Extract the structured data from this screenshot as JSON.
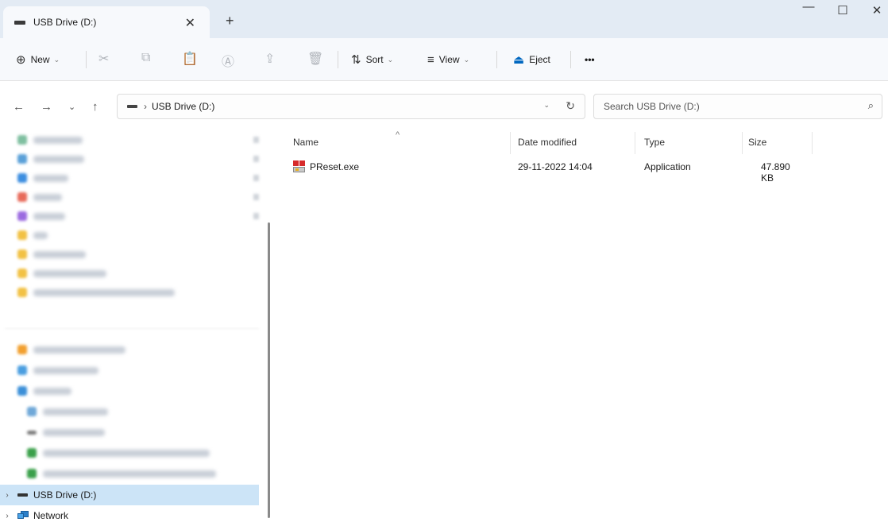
{
  "window": {
    "tab_title": "USB Drive (D:)",
    "tab_close": "✕",
    "new_tab": "+",
    "min": "—",
    "max": "☐",
    "close": "✕"
  },
  "toolbar": {
    "new_label": "New",
    "new_icon": "⊕",
    "sort_label": "Sort",
    "sort_icon": "⇅",
    "view_label": "View",
    "view_icon": "≡",
    "eject_label": "Eject",
    "eject_icon": "⏏",
    "more_label": "•••",
    "dropdown_chevron": "⌄",
    "cut_icon": "✂",
    "copy_icon": "⧉",
    "paste_icon": "📋",
    "rename_icon": "Ⓐ",
    "share_icon": "⇪",
    "delete_icon": "🗑"
  },
  "navigation": {
    "back": "←",
    "forward": "→",
    "recent": "⌄",
    "up": "↑",
    "breadcrumb_sep": "›",
    "breadcrumb": [
      "USB Drive (D:)"
    ],
    "address_dropdown": "⌄",
    "refresh": "↻"
  },
  "search": {
    "placeholder": "Search USB Drive (D:)",
    "icon": "⌕"
  },
  "sidebar": {
    "items": [
      {
        "label": "USB Drive (D:)",
        "expander": "›",
        "icon": "drive-icon",
        "selected": true
      },
      {
        "label": "Network",
        "expander": "›",
        "icon": "network-icon",
        "selected": false
      }
    ]
  },
  "file_list": {
    "columns": {
      "name": "Name",
      "date": "Date modified",
      "type": "Type",
      "size": "Size"
    },
    "sort_indicator": "^",
    "rows": [
      {
        "name": "PReset.exe",
        "date": "29-11-2022 14:04",
        "type": "Application",
        "size": "47.890 KB",
        "icon": "application-icon"
      }
    ]
  },
  "colors": {
    "titlebar": "#e3ebf4",
    "toolbar": "#f7f9fc",
    "selection": "#cce4f7",
    "accent": "#0067c0"
  }
}
